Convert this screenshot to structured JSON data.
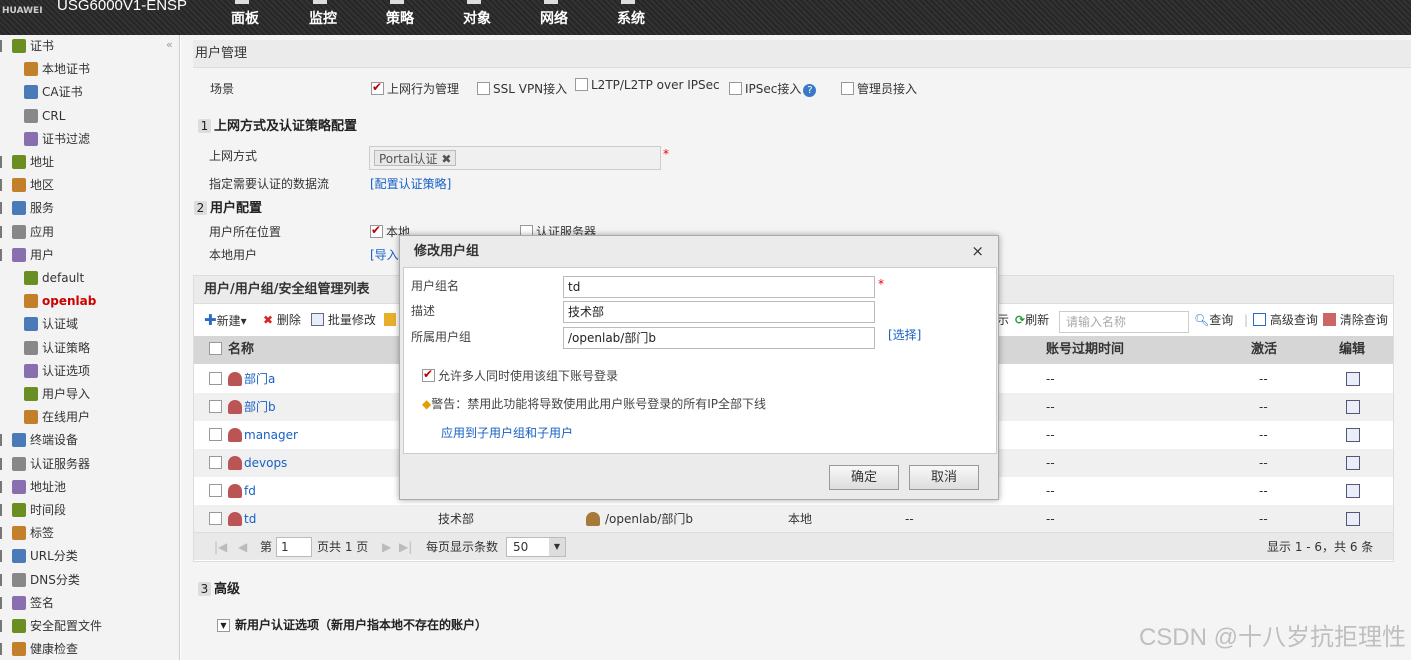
{
  "header": {
    "brand": "HUAWEI",
    "device": "USG6000V1-ENSP",
    "nav": [
      "面板",
      "监控",
      "策略",
      "对象",
      "网络",
      "系统"
    ]
  },
  "sidebar": {
    "items": [
      {
        "label": "证书",
        "level": 0,
        "icon": "certificate-icon"
      },
      {
        "label": "本地证书",
        "level": 1,
        "icon": "local-cert-icon"
      },
      {
        "label": "CA证书",
        "level": 1,
        "icon": "ca-cert-icon"
      },
      {
        "label": "CRL",
        "level": 1,
        "icon": "crl-icon"
      },
      {
        "label": "证书过滤",
        "level": 1,
        "icon": "cert-filter-icon"
      },
      {
        "label": "地址",
        "level": 0,
        "icon": "address-icon"
      },
      {
        "label": "地区",
        "level": 0,
        "icon": "region-icon"
      },
      {
        "label": "服务",
        "level": 0,
        "icon": "service-icon"
      },
      {
        "label": "应用",
        "level": 0,
        "icon": "application-icon"
      },
      {
        "label": "用户",
        "level": 0,
        "icon": "user-icon"
      },
      {
        "label": "default",
        "level": 1,
        "icon": "user-group-icon"
      },
      {
        "label": "openlab",
        "level": 1,
        "icon": "user-group-icon",
        "active": true
      },
      {
        "label": "认证域",
        "level": 1,
        "icon": "auth-domain-icon"
      },
      {
        "label": "认证策略",
        "level": 1,
        "icon": "auth-policy-icon"
      },
      {
        "label": "认证选项",
        "level": 1,
        "icon": "auth-option-icon"
      },
      {
        "label": "用户导入",
        "level": 1,
        "icon": "user-import-icon"
      },
      {
        "label": "在线用户",
        "level": 1,
        "icon": "online-user-icon"
      },
      {
        "label": "终端设备",
        "level": 0,
        "icon": "terminal-icon"
      },
      {
        "label": "认证服务器",
        "level": 0,
        "icon": "auth-server-icon"
      },
      {
        "label": "地址池",
        "level": 0,
        "icon": "address-pool-icon"
      },
      {
        "label": "时间段",
        "level": 0,
        "icon": "time-range-icon"
      },
      {
        "label": "标签",
        "level": 0,
        "icon": "tag-icon"
      },
      {
        "label": "URL分类",
        "level": 0,
        "icon": "url-category-icon"
      },
      {
        "label": "DNS分类",
        "level": 0,
        "icon": "dns-category-icon"
      },
      {
        "label": "签名",
        "level": 0,
        "icon": "signature-icon"
      },
      {
        "label": "安全配置文件",
        "level": 0,
        "icon": "security-profile-icon"
      },
      {
        "label": "健康检查",
        "level": 0,
        "icon": "health-check-icon"
      }
    ]
  },
  "panel": {
    "title": "用户管理",
    "scene_label": "场景",
    "scenes": [
      {
        "label": "上网行为管理",
        "checked": true
      },
      {
        "label": "SSL VPN接入",
        "checked": false
      },
      {
        "label": "L2TP/L2TP over IPSec",
        "checked": false
      },
      {
        "label": "IPSec接入",
        "checked": false
      },
      {
        "label": "管理员接入",
        "checked": false
      }
    ],
    "section1": {
      "num": "1",
      "title": "上网方式及认证策略配置"
    },
    "access_method_label": "上网方式",
    "access_method_value": "Portal认证",
    "dataflow_label": "指定需要认证的数据流",
    "dataflow_link": "[配置认证策略]",
    "section2": {
      "num": "2",
      "title": "用户配置"
    },
    "user_location_label": "用户所在位置",
    "location_local": "本地",
    "location_server": "认证服务器",
    "local_user_label": "本地用户",
    "local_user_link": "[导入]",
    "section3": {
      "num": "3",
      "title": "高级"
    },
    "new_user_option": "新用户认证选项（新用户指本地不存在的账户）"
  },
  "table": {
    "title": "用户/用户组/安全组管理列表",
    "toolbar": {
      "new": "新建▾",
      "delete": "删除",
      "batch_edit": "批量修改",
      "show": "示",
      "refresh": "刷新",
      "search_placeholder": "请输入名称",
      "query": "查询",
      "advanced_query": "高级查询",
      "clear_query": "清除查询"
    },
    "headers": {
      "name": "名称",
      "expire": "账号过期时间",
      "active": "激活",
      "edit": "编辑"
    },
    "rows": [
      {
        "name": "部门a",
        "desc": "",
        "group": "",
        "location": "",
        "col5": "",
        "expire": "--",
        "active": "--"
      },
      {
        "name": "部门b",
        "desc": "",
        "group": "",
        "location": "",
        "col5": "",
        "expire": "--",
        "active": "--"
      },
      {
        "name": "manager",
        "desc": "",
        "group": "",
        "location": "",
        "col5": "",
        "expire": "--",
        "active": "--"
      },
      {
        "name": "devops",
        "desc": "",
        "group": "",
        "location": "",
        "col5": "",
        "expire": "--",
        "active": "--"
      },
      {
        "name": "fd",
        "desc": "",
        "group": "",
        "location": "",
        "col5": "",
        "expire": "--",
        "active": "--"
      },
      {
        "name": "td",
        "desc": "技术部",
        "group": "/openlab/部门b",
        "location": "本地",
        "col5": "--",
        "expire": "--",
        "active": "--"
      }
    ],
    "pager": {
      "page_prefix": "第",
      "page": "1",
      "page_total": "页共 1 页",
      "per_page_label": "每页显示条数",
      "per_page": "50",
      "summary": "显示 1 - 6，共 6 条"
    }
  },
  "dialog": {
    "title": "修改用户组",
    "close": "×",
    "name_label": "用户组名",
    "name_value": "td",
    "desc_label": "描述",
    "desc_value": "技术部",
    "parent_label": "所属用户组",
    "parent_value": "/openlab/部门b",
    "select_link": "[选择]",
    "allow_multi": "允许多人同时使用该组下账号登录",
    "warning": "警告：禁用此功能将导致使用此用户账号登录的所有IP全部下线",
    "apply_link": "应用到子用户组和子用户",
    "ok": "确定",
    "cancel": "取消"
  },
  "watermark": "CSDN @十八岁抗拒理性"
}
